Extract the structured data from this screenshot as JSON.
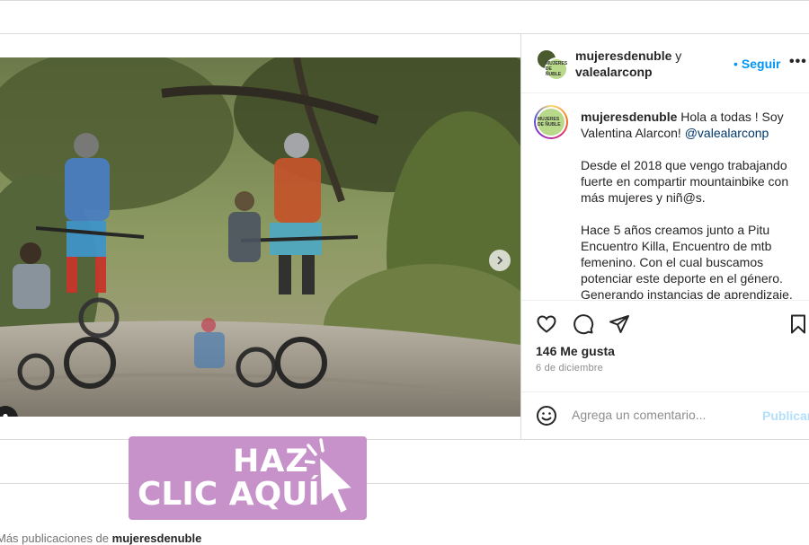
{
  "post": {
    "header": {
      "user1": "mujeresdenuble",
      "conj": " y",
      "user2": "valealarconp",
      "follow_label": "Seguir",
      "more_label": "•••"
    },
    "caption": {
      "author": "mujeresdenuble",
      "line1": " Hola a todas ! Soy Valentina Alarcon! ",
      "mention": "@valealarconp",
      "para2": "Desde el 2018 que vengo trabajando fuerte en compartir mountainbike con más mujeres y niñ@s.",
      "para3": "Hace 5 años creamos junto a Pitu Encuentro Killa, Encuentro de mtb femenino. Con el cual buscamos potenciar este deporte en el género. Generando instancias de aprendizaje,"
    },
    "likes": "146 Me gusta",
    "date": "6 de diciembre",
    "comment": {
      "placeholder": "Agrega un comentario...",
      "publish_label": "Publicar"
    },
    "avatar_logo_text": "MUJERES DE ÑUBLE"
  },
  "more_posts": {
    "prefix": "Más publicaciones de ",
    "user": "mujeresdenuble"
  },
  "cta": {
    "line1": "HAZ",
    "line2": "CLIC AQUÍ"
  },
  "icons": {
    "like": "heart-icon",
    "comment": "comment-icon",
    "share": "share-icon",
    "save": "bookmark-icon",
    "emoji": "emoji-icon",
    "next": "chevron-right-icon",
    "tag": "user-tag-icon"
  },
  "colors": {
    "link": "#0095f6",
    "publish_disabled": "#b2dffc",
    "cta_bg": "#c792c9",
    "mention": "#00376b"
  }
}
